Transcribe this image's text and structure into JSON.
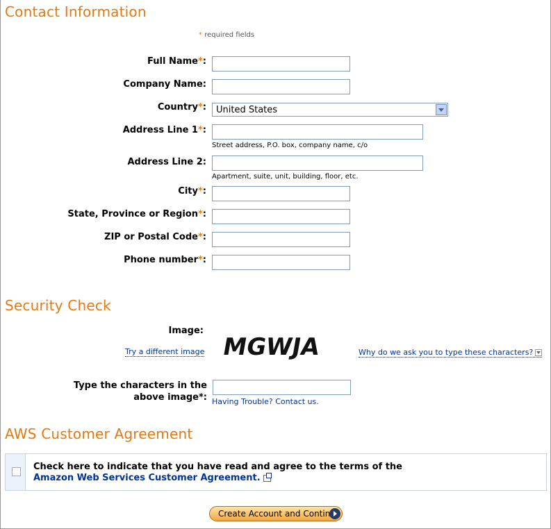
{
  "contact": {
    "title": "Contact Information",
    "required_star": "*",
    "required_note": "required fields",
    "fields": [
      {
        "label": "Full Name",
        "required": true
      },
      {
        "label": "Company Name",
        "required": false
      },
      {
        "label": "Country",
        "required": true,
        "value": "United States"
      },
      {
        "label": "Address Line 1",
        "required": true,
        "hint": "Street address, P.O. box, company name, c/o"
      },
      {
        "label": "Address Line 2",
        "required": false,
        "hint": "Apartment, suite, unit, building, floor, etc."
      },
      {
        "label": "City",
        "required": true
      },
      {
        "label": "State, Province or Region",
        "required": true
      },
      {
        "label": "ZIP or Postal Code",
        "required": true
      },
      {
        "label": "Phone number",
        "required": true
      }
    ]
  },
  "security": {
    "title": "Security Check",
    "image_label": "Image:",
    "captcha_text": "MGWJA",
    "try_different": "Try a different image",
    "why_ask": "Why do we ask you to type these characters?",
    "type_label_line1": "Type the characters in the",
    "type_label_line2": "above image*:",
    "trouble": "Having Trouble? Contact us."
  },
  "agreement": {
    "title": "AWS Customer Agreement",
    "text": "Check here to indicate that you have read and agree to the terms of the",
    "link": "Amazon Web Services Customer Agreement."
  },
  "submit_label": "Create Account and Continue",
  "colors": {
    "accent": "#e47911",
    "link": "#003399"
  }
}
